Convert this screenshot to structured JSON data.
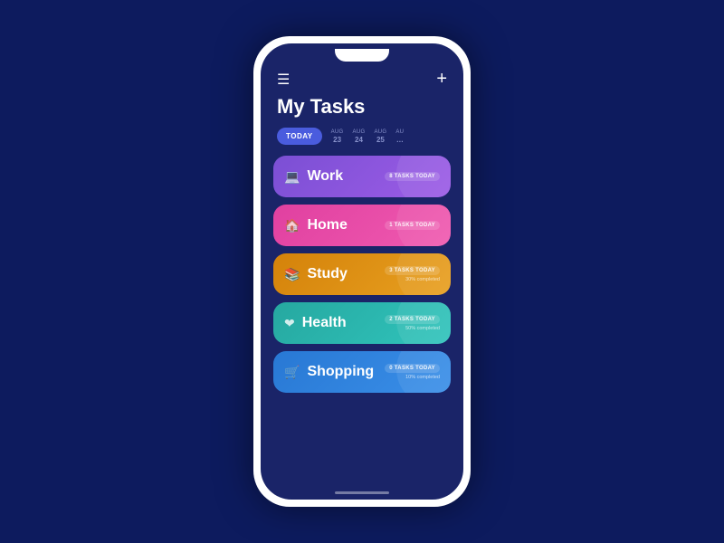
{
  "app": {
    "title": "My Tasks",
    "menu_icon": "☰",
    "add_icon": "+"
  },
  "date_strip": {
    "today_label": "TODAY",
    "dates": [
      {
        "month": "AUG",
        "day": "23"
      },
      {
        "month": "AUG",
        "day": "24"
      },
      {
        "month": "AUG",
        "day": "25"
      },
      {
        "month": "AU",
        "day": "..."
      }
    ]
  },
  "tasks": [
    {
      "name": "Work",
      "icon": "🖥",
      "color_class": "task-card-work",
      "count": "8 TASKS",
      "period": "today",
      "progress": ""
    },
    {
      "name": "Home",
      "icon": "🏠",
      "color_class": "task-card-home",
      "count": "1 TASKS",
      "period": "today",
      "progress": ""
    },
    {
      "name": "Study",
      "icon": "📖",
      "color_class": "task-card-study",
      "count": "3 TASKS",
      "period": "today",
      "progress": "30% completed"
    },
    {
      "name": "Health",
      "icon": "❤",
      "color_class": "task-card-health",
      "count": "2 TASKS",
      "period": "today",
      "progress": "50% completed"
    },
    {
      "name": "Shopping",
      "icon": "🛒",
      "color_class": "task-card-shopping",
      "count": "0 TASKS",
      "period": "today",
      "progress": "10% completed"
    }
  ]
}
